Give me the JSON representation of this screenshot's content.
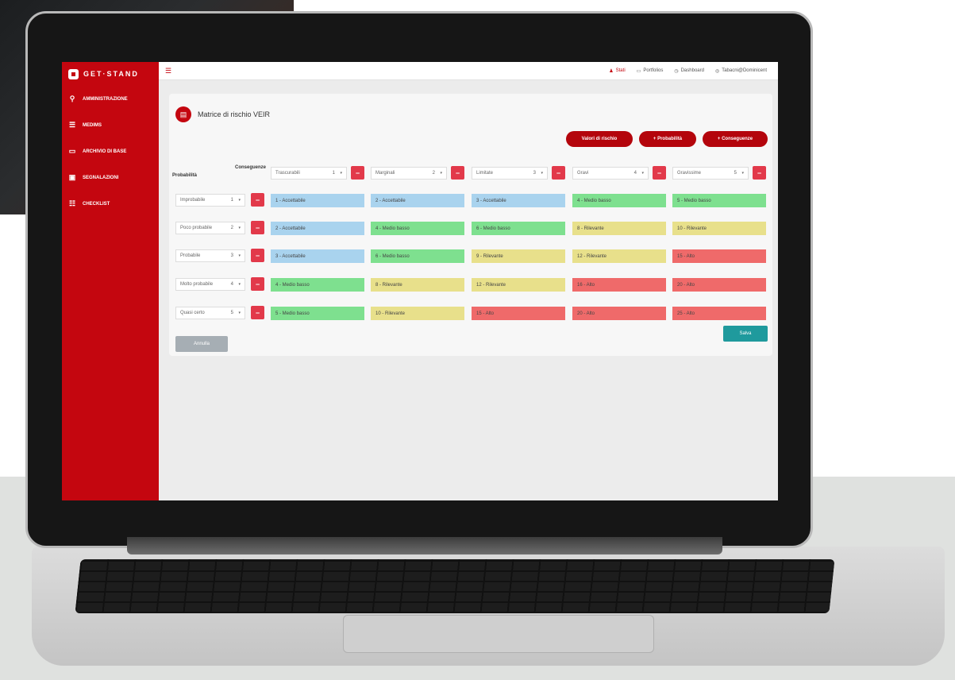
{
  "app": {
    "brand": "GET·STAND"
  },
  "colors": {
    "primary": "#c4060f",
    "low_blue": "#a9d3ee",
    "lowmed_green": "#7ee08f",
    "relevant_yellow": "#e8e08b",
    "high_red": "#ef6a6a",
    "save_teal": "#1f9a9d"
  },
  "sidebar": {
    "items": [
      {
        "label": "AMMINISTRAZIONE",
        "icon": "search-icon"
      },
      {
        "label": "MEDIMS",
        "icon": "list-icon"
      },
      {
        "label": "ARCHIVIO DI BASE",
        "icon": "archive-icon"
      },
      {
        "label": "SEGNALAZIONI",
        "icon": "report-icon"
      },
      {
        "label": "CHECKLIST",
        "icon": "checklist-icon"
      }
    ]
  },
  "topbar": {
    "menu_icon": "menu-icon",
    "links": [
      {
        "label": "Stati",
        "icon": "user-icon",
        "active": true
      },
      {
        "label": "Portfolios",
        "icon": "portfolio-icon",
        "active": false
      },
      {
        "label": "Dashboard",
        "icon": "dashboard-icon",
        "active": false
      },
      {
        "label": "Tabacni@Dominicent",
        "icon": "account-icon",
        "active": false
      }
    ]
  },
  "page": {
    "title": "Matrice di rischio VEIR",
    "buttons": {
      "values": "Valori di rischio",
      "probability": "+ Probabilità",
      "consequences": "+ Conseguenze"
    },
    "probability_label": "Probabilità",
    "consequences_label": "Conseguenze",
    "consequences": [
      {
        "label": "Trascurabili",
        "value": "1"
      },
      {
        "label": "Marginali",
        "value": "2"
      },
      {
        "label": "Limitate",
        "value": "3"
      },
      {
        "label": "Gravi",
        "value": "4"
      },
      {
        "label": "Gravissime",
        "value": "5"
      }
    ],
    "probabilities": [
      {
        "label": "Improbabile",
        "value": "1"
      },
      {
        "label": "Poco probabile",
        "value": "2"
      },
      {
        "label": "Probabile",
        "value": "3"
      },
      {
        "label": "Molto probabile",
        "value": "4"
      },
      {
        "label": "Quasi certo",
        "value": "5"
      }
    ],
    "matrix": [
      [
        {
          "text": "1 - Accettabile",
          "level": "low"
        },
        {
          "text": "2 - Accettabile",
          "level": "low"
        },
        {
          "text": "3 - Accettabile",
          "level": "low"
        },
        {
          "text": "4 - Medio basso",
          "level": "lowmed"
        },
        {
          "text": "5 - Medio basso",
          "level": "lowmed"
        }
      ],
      [
        {
          "text": "2 - Accettabile",
          "level": "low"
        },
        {
          "text": "4 - Medio basso",
          "level": "lowmed"
        },
        {
          "text": "6 - Medio basso",
          "level": "lowmed"
        },
        {
          "text": "8 - Rilevante",
          "level": "relevant"
        },
        {
          "text": "10 - Rilevante",
          "level": "relevant"
        }
      ],
      [
        {
          "text": "3 - Accettabile",
          "level": "low"
        },
        {
          "text": "6 - Medio basso",
          "level": "lowmed"
        },
        {
          "text": "9 - Rilevante",
          "level": "relevant"
        },
        {
          "text": "12 - Rilevante",
          "level": "relevant"
        },
        {
          "text": "15 - Alto",
          "level": "high"
        }
      ],
      [
        {
          "text": "4 - Medio basso",
          "level": "lowmed"
        },
        {
          "text": "8 - Rilevante",
          "level": "relevant"
        },
        {
          "text": "12 - Rilevante",
          "level": "relevant"
        },
        {
          "text": "16 - Alto",
          "level": "high"
        },
        {
          "text": "20 - Alto",
          "level": "high"
        }
      ],
      [
        {
          "text": "5 - Medio basso",
          "level": "lowmed"
        },
        {
          "text": "10 - Rilevante",
          "level": "relevant"
        },
        {
          "text": "15 - Alto",
          "level": "high"
        },
        {
          "text": "20 - Alto",
          "level": "high"
        },
        {
          "text": "25 - Alto",
          "level": "high"
        }
      ]
    ],
    "reset_button": "Annulla",
    "save_button": "Salva"
  }
}
